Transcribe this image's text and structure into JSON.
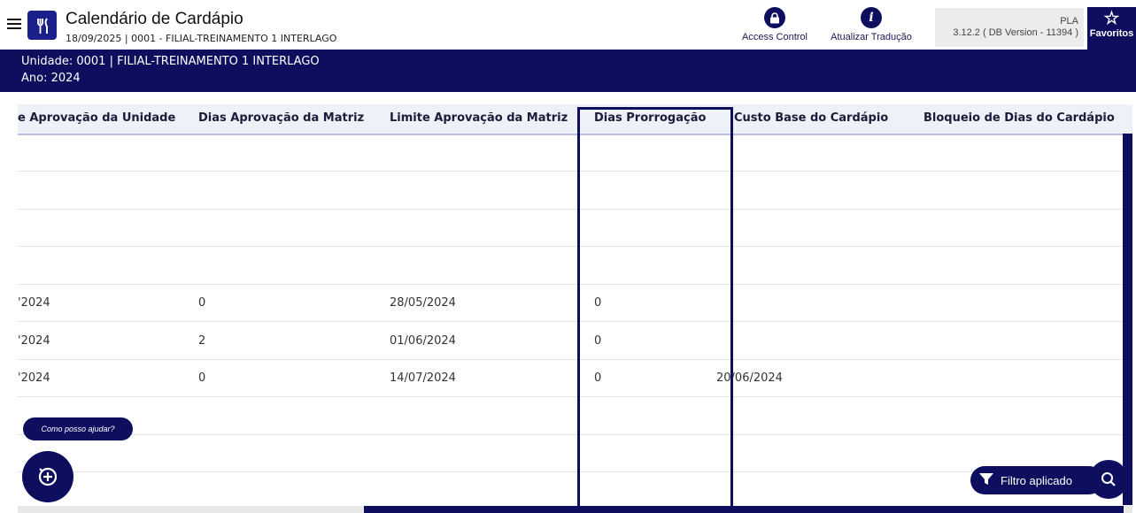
{
  "header": {
    "app_title": "Calendário de Cardápio",
    "subtitle": "18/09/2025 | 0001 - FILIAL-TREINAMENTO 1 INTERLAGO",
    "access_control_label": "Access Control",
    "atualizar_label": "Atualizar Tradução",
    "version_line1": "PLA",
    "version_line2": "3.12.2 ( DB Version - 11394 )",
    "favoritos_label": "Favoritos"
  },
  "unit_bar": {
    "unidade": "Unidade: 0001 | FILIAL-TREINAMENTO 1 INTERLAGO",
    "ano": "Ano: 2024"
  },
  "table": {
    "headers": [
      "e Aprovação da Unidade",
      "Dias Aprovação da Matriz",
      "Limite Aprovação da Matriz",
      "Dias Prorrogação",
      "Custo Base do Cardápio",
      "Bloqueio de Dias do Cardápio"
    ],
    "rows": [
      [
        "",
        "",
        "",
        "",
        "",
        ""
      ],
      [
        "",
        "",
        "",
        "",
        "",
        ""
      ],
      [
        "",
        "",
        "",
        "",
        "",
        ""
      ],
      [
        "",
        "",
        "",
        "",
        "",
        ""
      ],
      [
        "'2024",
        "0",
        "28/05/2024",
        "0",
        "",
        ""
      ],
      [
        "'2024",
        "2",
        "01/06/2024",
        "0",
        "",
        ""
      ],
      [
        "'2024",
        "0",
        "14/07/2024",
        "0",
        "20/06/2024",
        ""
      ],
      [
        "",
        "",
        "",
        "",
        "",
        ""
      ],
      [
        "",
        "",
        "",
        "",
        "",
        ""
      ],
      [
        "",
        "",
        "",
        "",
        "",
        ""
      ]
    ]
  },
  "help": {
    "bubble_text": "Como posso ajudar?"
  },
  "filter": {
    "label": "Filtro aplicado"
  },
  "icons": {
    "menu": "hamburger-menu-icon",
    "logo": "fork-knife-icon",
    "access": "lock-icon",
    "info": "info-icon",
    "favorite": "star-icon",
    "help": "assistant-icon",
    "filter": "funnel-icon",
    "search": "search-icon"
  },
  "colors": {
    "primary": "#0d0f5e",
    "header_bg": "#eef1f7"
  }
}
